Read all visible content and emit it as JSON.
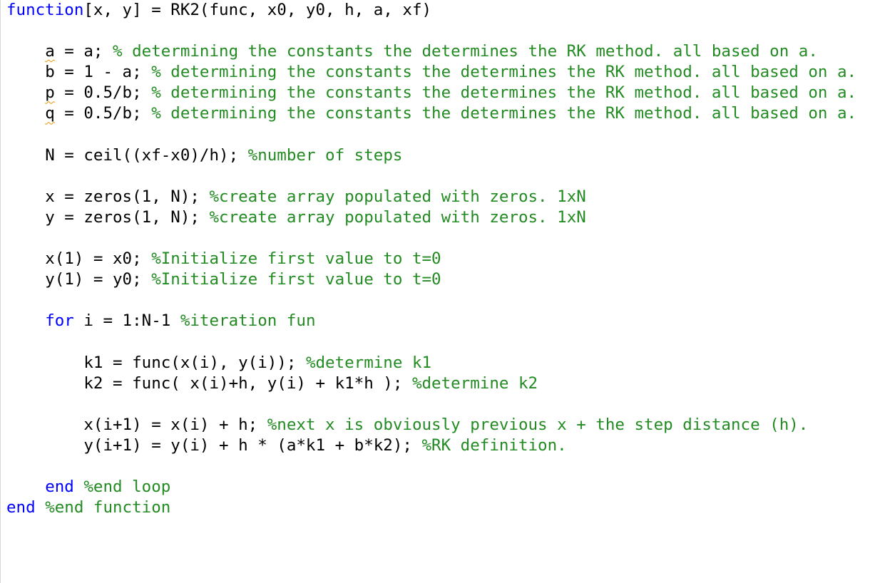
{
  "editor": {
    "lines": [
      {
        "indent": "",
        "kw": "function",
        "code": "[x, y] = RK2(func, x0, y0, h, a, xf)",
        "comment": ""
      },
      {
        "indent": "",
        "kw": "",
        "code": "",
        "comment": ""
      },
      {
        "indent": "    ",
        "kw": "",
        "warn": "a",
        "code": " = a; ",
        "comment": "% determining the constants the determines the RK method. all based on a."
      },
      {
        "indent": "    ",
        "kw": "",
        "code": "b = 1 - a; ",
        "comment": "% determining the constants the determines the RK method. all based on a."
      },
      {
        "indent": "    ",
        "kw": "",
        "warn": "p",
        "code": " = 0.5/b; ",
        "comment": "% determining the constants the determines the RK method. all based on a."
      },
      {
        "indent": "    ",
        "kw": "",
        "warn": "q",
        "code": " = 0.5/b; ",
        "comment": "% determining the constants the determines the RK method. all based on a."
      },
      {
        "indent": "",
        "kw": "",
        "code": "",
        "comment": ""
      },
      {
        "indent": "    ",
        "kw": "",
        "code": "N = ceil((xf-x0)/h); ",
        "comment": "%number of steps"
      },
      {
        "indent": "",
        "kw": "",
        "code": "",
        "comment": ""
      },
      {
        "indent": "    ",
        "kw": "",
        "code": "x = zeros(1, N); ",
        "comment": "%create array populated with zeros. 1xN"
      },
      {
        "indent": "    ",
        "kw": "",
        "code": "y = zeros(1, N); ",
        "comment": "%create array populated with zeros. 1xN"
      },
      {
        "indent": "",
        "kw": "",
        "code": "",
        "comment": ""
      },
      {
        "indent": "    ",
        "kw": "",
        "code": "x(1) = x0; ",
        "comment": "%Initialize first value to t=0"
      },
      {
        "indent": "    ",
        "kw": "",
        "code": "y(1) = y0; ",
        "comment": "%Initialize first value to t=0"
      },
      {
        "indent": "",
        "kw": "",
        "code": "",
        "comment": ""
      },
      {
        "indent": "    ",
        "kw": "for",
        "code": " i = 1:N-1 ",
        "comment": "%iteration fun"
      },
      {
        "indent": "",
        "kw": "",
        "code": "",
        "comment": ""
      },
      {
        "indent": "        ",
        "kw": "",
        "code": "k1 = func(x(i), y(i)); ",
        "comment": "%determine k1"
      },
      {
        "indent": "        ",
        "kw": "",
        "code": "k2 = func( x(i)+h, y(i) + k1*h ); ",
        "comment": "%determine k2"
      },
      {
        "indent": "",
        "kw": "",
        "code": "",
        "comment": ""
      },
      {
        "indent": "        ",
        "kw": "",
        "code": "x(i+1) = x(i) + h; ",
        "comment": "%next x is obviously previous x + the step distance (h)."
      },
      {
        "indent": "        ",
        "kw": "",
        "code": "y(i+1) = y(i) + h * (a*k1 + b*k2); ",
        "comment": "%RK definition."
      },
      {
        "indent": "",
        "kw": "",
        "code": "",
        "comment": ""
      },
      {
        "indent": "    ",
        "kw": "end",
        "code": " ",
        "comment": "%end loop"
      },
      {
        "indent": "",
        "kw": "end",
        "code": " ",
        "comment": "%end function"
      }
    ]
  },
  "colors": {
    "keyword": "#0000ff",
    "comment": "#228b22",
    "text": "#000000",
    "warning_underline": "#e69500"
  }
}
